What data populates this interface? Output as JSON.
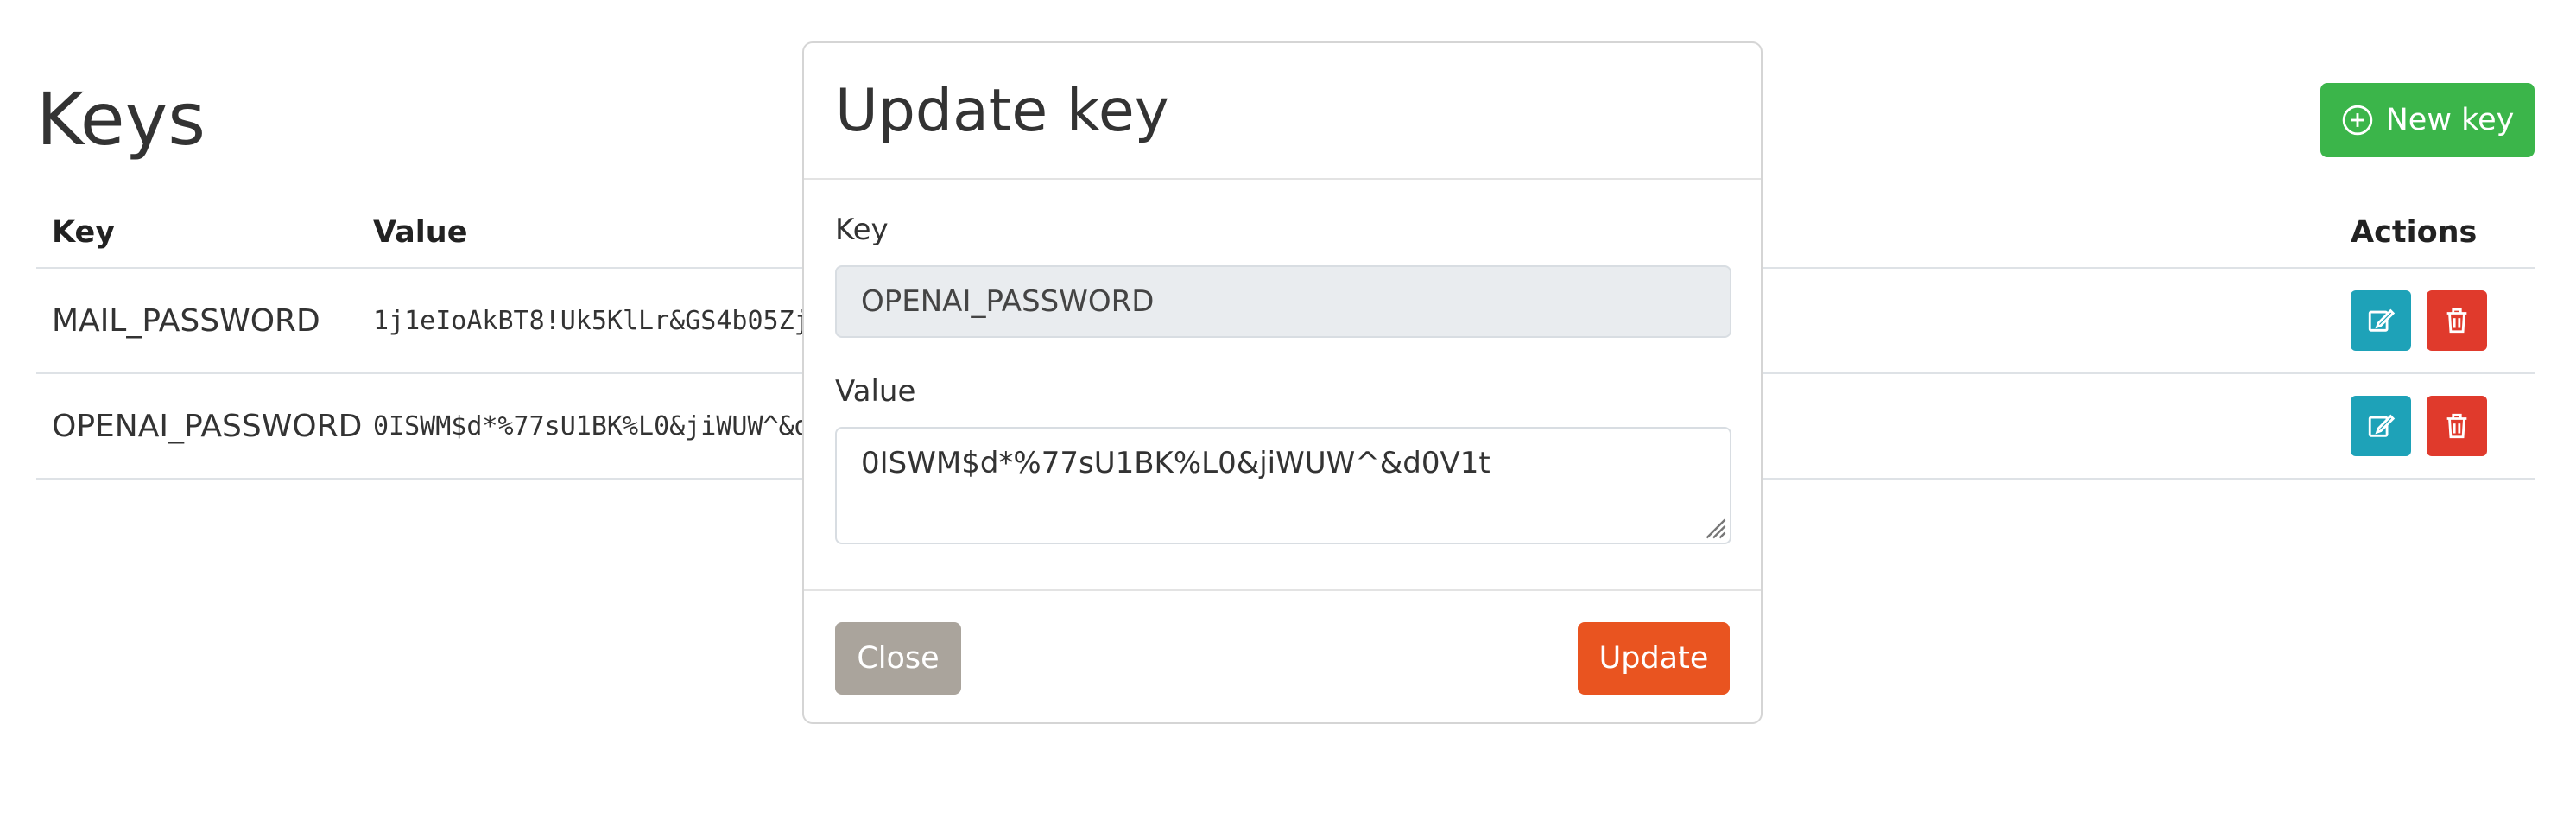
{
  "page": {
    "title": "Keys"
  },
  "toolbar": {
    "new_key_label": "New key",
    "new_key_icon": "plus-circle-icon"
  },
  "table": {
    "headers": {
      "key": "Key",
      "value": "Value",
      "actions": "Actions"
    },
    "rows": [
      {
        "key": "MAIL_PASSWORD",
        "value": "1j1eIoAkBT8!Uk5KlLr&GS4b05Zj4"
      },
      {
        "key": "OPENAI_PASSWORD",
        "value": "0ISWM$d*%77sU1BK%L0&jiWUW^&d0"
      }
    ],
    "action_icons": {
      "edit": "edit-icon",
      "delete": "trash-icon"
    }
  },
  "modal": {
    "title": "Update key",
    "key_label": "Key",
    "key_value": "OPENAI_PASSWORD",
    "value_label": "Value",
    "value_value": "0ISWM$d*%77sU1BK%L0&jiWUW^&d0V1t",
    "close_label": "Close",
    "update_label": "Update"
  },
  "colors": {
    "success": "#3bb54a",
    "info": "#1ea2b8",
    "danger": "#e03a2c",
    "primary": "#e95420",
    "secondary": "#aaa49c"
  }
}
